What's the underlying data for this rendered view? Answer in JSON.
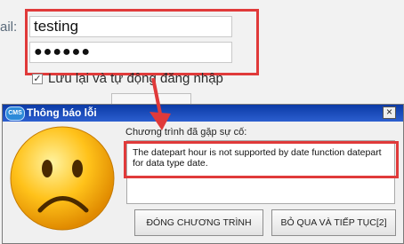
{
  "login": {
    "field_label": "ail:",
    "username": "testing",
    "password_mask": "●●●●●●",
    "remember_label": "Lưu lại và tự động đăng nhập",
    "remember_checked": "✓"
  },
  "dialog": {
    "title": "Thông báo lỗi",
    "app_icon_text": "CMS",
    "close_glyph": "×",
    "problem_label": "Chương trình đã gặp sự cố:",
    "error_message": "The datepart hour is not supported by date function datepart for data type date.",
    "buttons": {
      "close_app": "ĐÓNG CHƯƠNG TRÌNH",
      "skip": "BỎ QUA VÀ TIẾP TỤC[2]"
    }
  },
  "colors": {
    "annotation_red": "#e03a3a",
    "title_bar_blue": "#0b3aa6"
  },
  "icons": [
    "app-icon",
    "close-icon",
    "sad-face-icon",
    "arrow-icon",
    "checkbox-icon"
  ]
}
